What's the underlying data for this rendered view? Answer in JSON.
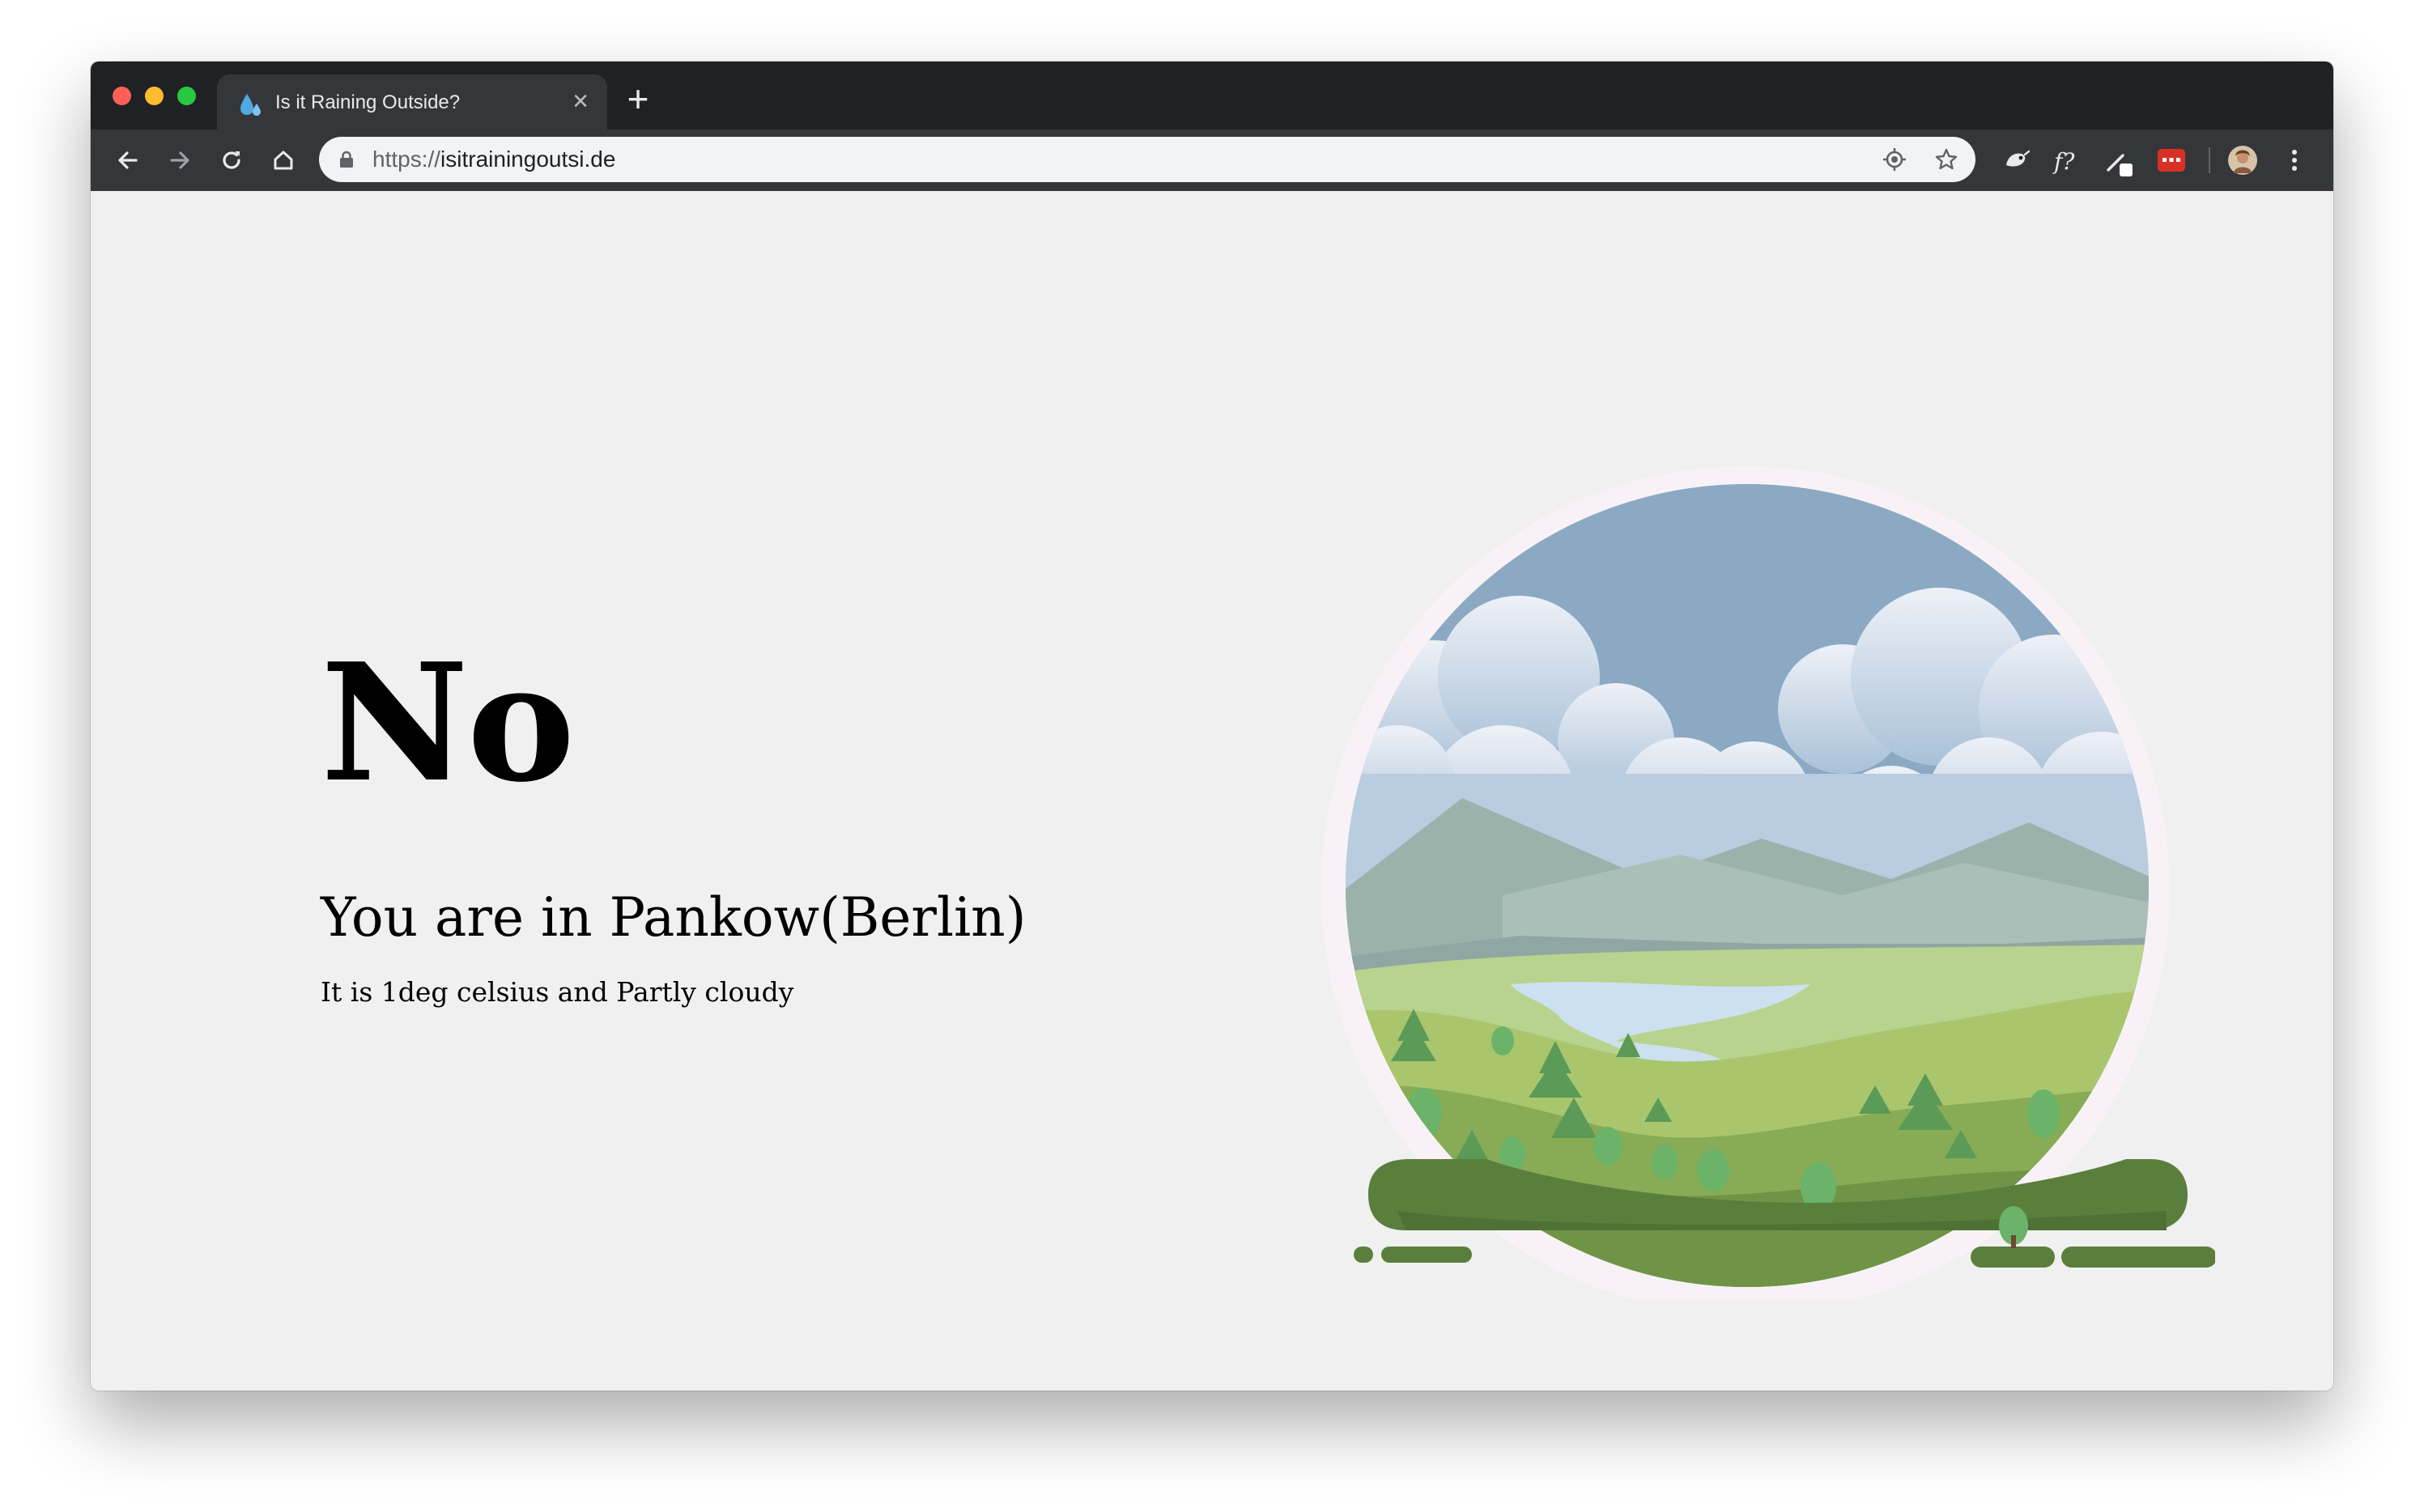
{
  "browser": {
    "tab": {
      "title": "Is it Raining Outside?",
      "favicon": "water-drops-icon"
    },
    "new_tab_label": "+",
    "close_tab_label": "×",
    "address": {
      "scheme": "https://",
      "host": "isitrainingoutsi.de"
    },
    "toolbar_icons": [
      "back-arrow-icon",
      "forward-arrow-icon",
      "reload-icon",
      "home-icon"
    ],
    "omnibox_icons": [
      "location-target-icon",
      "bookmark-star-icon"
    ],
    "extension_icons": [
      "extension-bird-icon",
      "extension-fontface-icon",
      "extension-pen-icon",
      "extension-red-icon",
      "profile-avatar",
      "more-menu-icon"
    ]
  },
  "page": {
    "answer": "No",
    "location_line": "You are in Pankow(Berlin)",
    "weather_line": "It is 1deg celsius and Partly cloudy",
    "illustration": "landscape-illustration"
  },
  "colors": {
    "tab_strip": "#202124",
    "toolbar": "#35363a",
    "page_background": "#f0f0f0",
    "sky": "#8ba9c3",
    "mountains": "#9bb2ab",
    "grass": "#88ab55",
    "ground": "#5a7f3d",
    "river": "#cde0ef"
  }
}
